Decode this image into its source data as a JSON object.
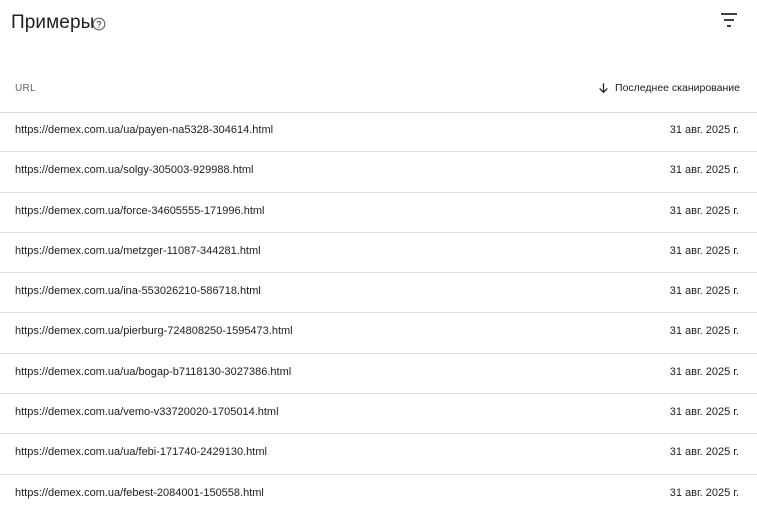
{
  "header": {
    "title": "Примеры",
    "help_icon": "help-circle-icon",
    "filter_icon": "filter-list-icon"
  },
  "table": {
    "columns": {
      "url": "URL",
      "last_crawl": "Последнее сканирование",
      "sort_icon": "arrow-down-icon"
    },
    "rows": [
      {
        "url": "https://demex.com.ua/ua/payen-na5328-304614.html",
        "date": "31 авг. 2025 г."
      },
      {
        "url": "https://demex.com.ua/solgy-305003-929988.html",
        "date": "31 авг. 2025 г."
      },
      {
        "url": "https://demex.com.ua/force-34605555-171996.html",
        "date": "31 авг. 2025 г."
      },
      {
        "url": "https://demex.com.ua/metzger-11087-344281.html",
        "date": "31 авг. 2025 г."
      },
      {
        "url": "https://demex.com.ua/ina-553026210-586718.html",
        "date": "31 авг. 2025 г."
      },
      {
        "url": "https://demex.com.ua/pierburg-724808250-1595473.html",
        "date": "31 авг. 2025 г."
      },
      {
        "url": "https://demex.com.ua/ua/bogap-b7118130-3027386.html",
        "date": "31 авг. 2025 г."
      },
      {
        "url": "https://demex.com.ua/vemo-v33720020-1705014.html",
        "date": "31 авг. 2025 г."
      },
      {
        "url": "https://demex.com.ua/ua/febi-171740-2429130.html",
        "date": "31 авг. 2025 г."
      },
      {
        "url": "https://demex.com.ua/febest-2084001-150558.html",
        "date": "31 авг. 2025 г."
      }
    ]
  }
}
